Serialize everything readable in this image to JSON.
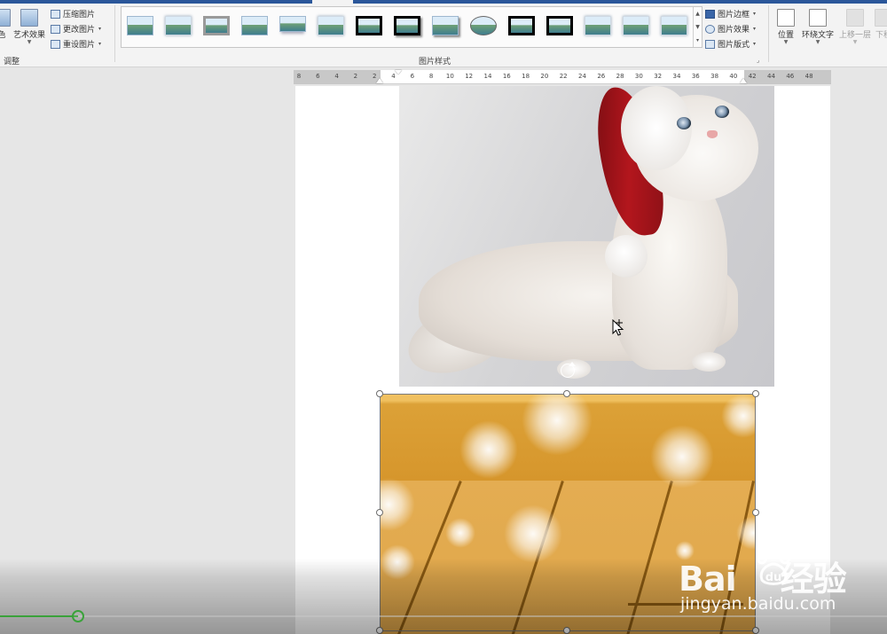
{
  "ribbon": {
    "color_btn_partial": "色",
    "artistic_effects": "艺术效果",
    "compress": "压缩图片",
    "change": "更改图片",
    "reset": "重设图片",
    "adjust_group": "调整",
    "styles_group": "图片样式",
    "border": "图片边框",
    "effects": "图片效果",
    "layout": "图片版式",
    "position": "位置",
    "wrap_text": "环绕文字",
    "bring_forward": "上移一层",
    "send_backward": "下移"
  },
  "ruler": {
    "ticks": [
      "8",
      "6",
      "4",
      "2",
      "2",
      "4",
      "6",
      "8",
      "10",
      "12",
      "14",
      "16",
      "18",
      "20",
      "22",
      "24",
      "26",
      "28",
      "30",
      "32",
      "34",
      "36",
      "38",
      "40",
      "42",
      "44",
      "46",
      "48"
    ]
  },
  "video": {
    "progress_fraction": 0.088
  },
  "watermark": {
    "brand": "Bai",
    "brand_tail": "经验",
    "url": "jingyan.baidu.com"
  },
  "colors": {
    "accent_blue": "#2b579a",
    "progress_green": "#3aa23a"
  }
}
